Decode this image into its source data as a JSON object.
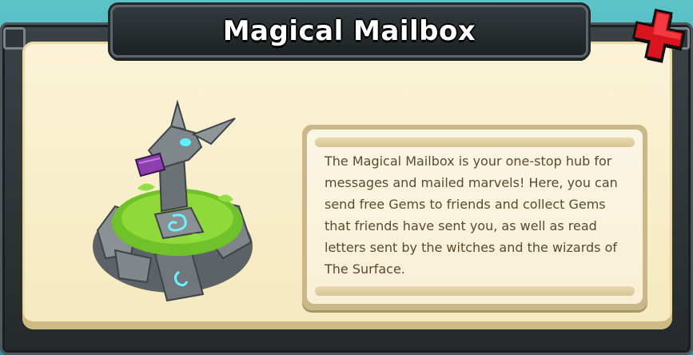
{
  "dialog": {
    "title": "Magical Mailbox",
    "close_icon": "close-x-icon",
    "illustration": "magical-mailbox-dragon-statue",
    "description": "The Magical Mailbox is your one-stop hub for messages and mailed marvels! Here, you can send free Gems to friends and collect Gems that friends have sent you, as well as read letters sent by the witches and the wizards of The Surface."
  },
  "colors": {
    "panel": "#f8eecb",
    "frame": "#2b3134",
    "close_button": "#e3212b",
    "text": "#5a4a2f"
  }
}
